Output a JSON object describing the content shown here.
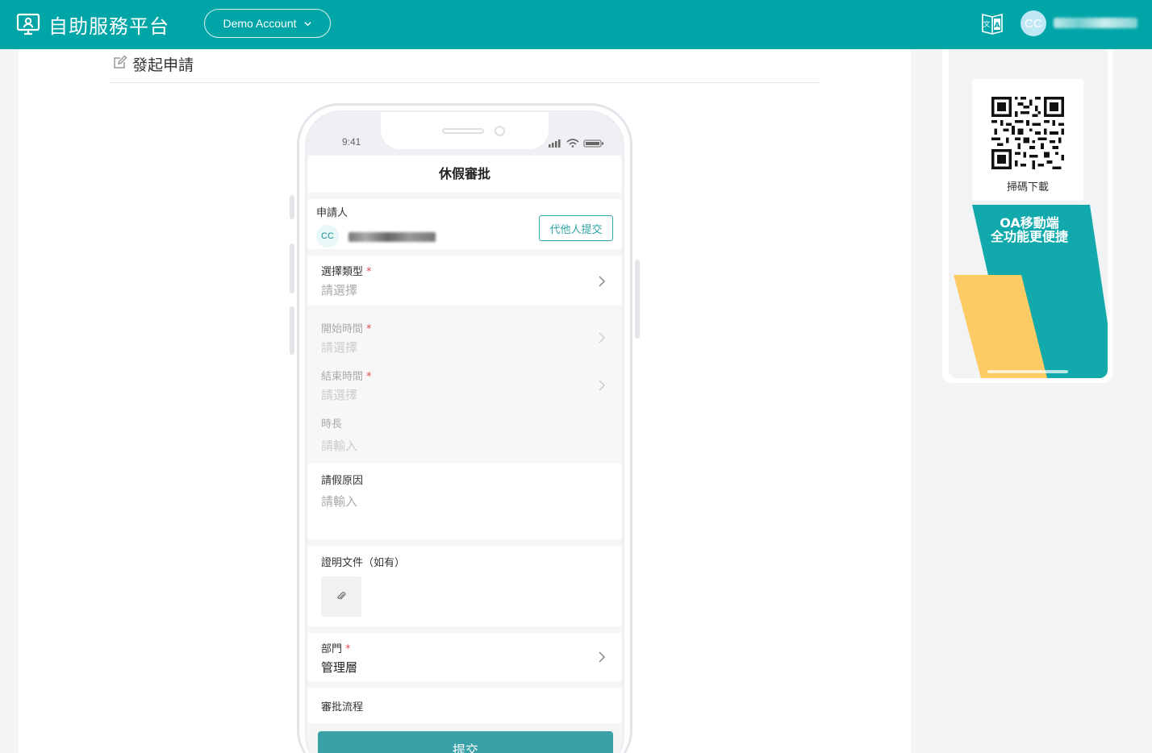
{
  "header": {
    "app_title": "自助服務平台",
    "account_label": "Demo Account",
    "avatar_initials": "CC",
    "brand_color": "#00a5a8"
  },
  "page": {
    "title": "發起申請"
  },
  "phone": {
    "time": "9:41",
    "nav_title": "休假審批",
    "applicant": {
      "label": "申請人",
      "avatar_initials": "CC",
      "proxy_button": "代他人提交"
    },
    "fields": {
      "type_label": "選擇類型",
      "type_placeholder": "請選擇",
      "start_label": "開始時間",
      "start_placeholder": "請選擇",
      "end_label": "結束時間",
      "end_placeholder": "請選擇",
      "duration_label": "時長",
      "duration_placeholder": "請輸入",
      "reason_label": "請假原因",
      "reason_placeholder": "請輸入",
      "attachment_label": "證明文件（如有）",
      "department_label": "部門",
      "department_value": "管理層",
      "flow_label": "審批流程",
      "required_mark": "*"
    },
    "submit_label": "提交"
  },
  "ad": {
    "qr_label": "掃碼下載",
    "promo_line1": "OA移動端",
    "promo_line2": "全功能更便捷"
  }
}
